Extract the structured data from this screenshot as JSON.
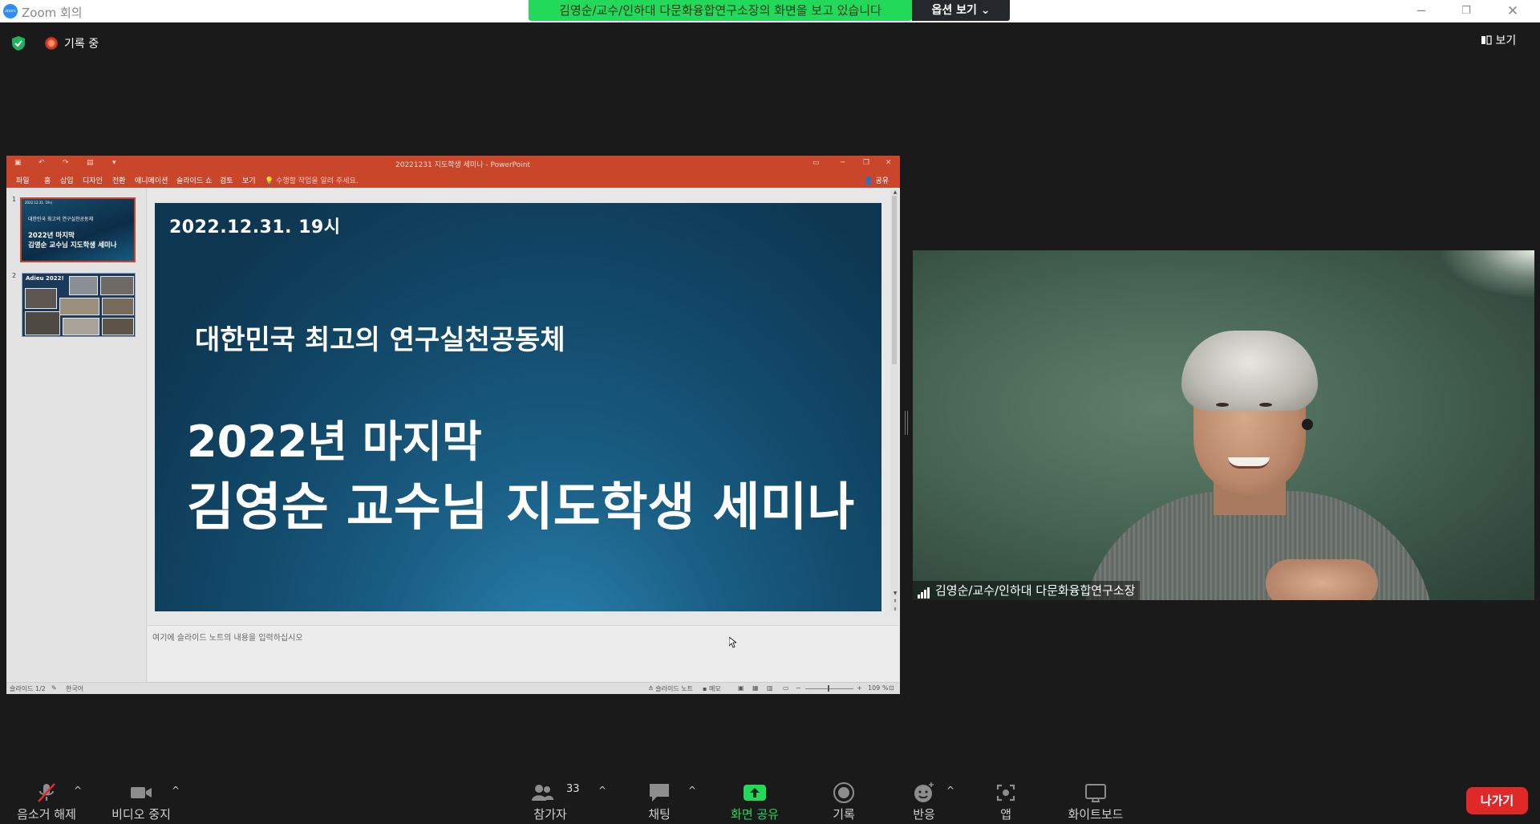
{
  "window": {
    "title": "Zoom 회의",
    "logo_text": "zoom",
    "share_banner": "김영순/교수/인하대 다문화융합연구소장의 화면을 보고 있습니다",
    "options_label": "옵션 보기 ⌄",
    "controls": [
      "minimize-icon",
      "restore-icon",
      "close-icon"
    ]
  },
  "status": {
    "recording_label": "기록 중",
    "view_label": "보기"
  },
  "powerpoint": {
    "title": "20221231 지도학생 세미나 - PowerPoint",
    "menu": [
      "파일",
      "홈",
      "삽입",
      "디자인",
      "전환",
      "애니메이션",
      "슬라이드 쇼",
      "검토",
      "보기"
    ],
    "tell_me": "수행할 작업을 알려 주세요.",
    "share": "공유",
    "thumbnails": [
      {
        "num": "1",
        "date": "2022.12.31. 19시",
        "subtitle": "대한민국 최고의 연구실천공동체",
        "title_line1": "2022년 마지막",
        "title_line2": "김영순 교수님 지도학생 세미나"
      },
      {
        "num": "2",
        "title": "Adieu 2022!"
      }
    ],
    "slide": {
      "date": "2022.12.31. 19시",
      "subtitle": "대한민국 최고의 연구실천공동체",
      "title_line1": "2022년 마지막",
      "title_line2": "김영순 교수님 지도학생 세미나"
    },
    "notes_placeholder": "여기에 슬라이드 노트의 내용을 입력하십시오",
    "statusbar": {
      "slide_count": "슬라이드 1/2",
      "language": "한국어",
      "notes": "슬라이드 노트",
      "comments": "메모",
      "zoom": "109 %"
    }
  },
  "participant_video": {
    "name": "김영순/교수/인하대 다문화융합연구소장"
  },
  "toolbar": {
    "items": [
      {
        "label": "음소거 해제",
        "icon": "microphone-muted-icon"
      },
      {
        "label": "비디오 중지",
        "icon": "video-camera-icon"
      },
      {
        "label": "참가자",
        "icon": "participants-icon",
        "count": "33"
      },
      {
        "label": "채팅",
        "icon": "chat-icon"
      },
      {
        "label": "화면 공유",
        "icon": "share-screen-icon"
      },
      {
        "label": "기록",
        "icon": "record-icon"
      },
      {
        "label": "반응",
        "icon": "reaction-icon"
      },
      {
        "label": "앱",
        "icon": "apps-icon"
      },
      {
        "label": "화이트보드",
        "icon": "whiteboard-icon"
      }
    ],
    "leave_label": "나가기"
  },
  "colors": {
    "share_banner": "#23d959",
    "share_icon": "#23d959",
    "leave": "#e02828",
    "ppt_accent": "#c9462b"
  }
}
